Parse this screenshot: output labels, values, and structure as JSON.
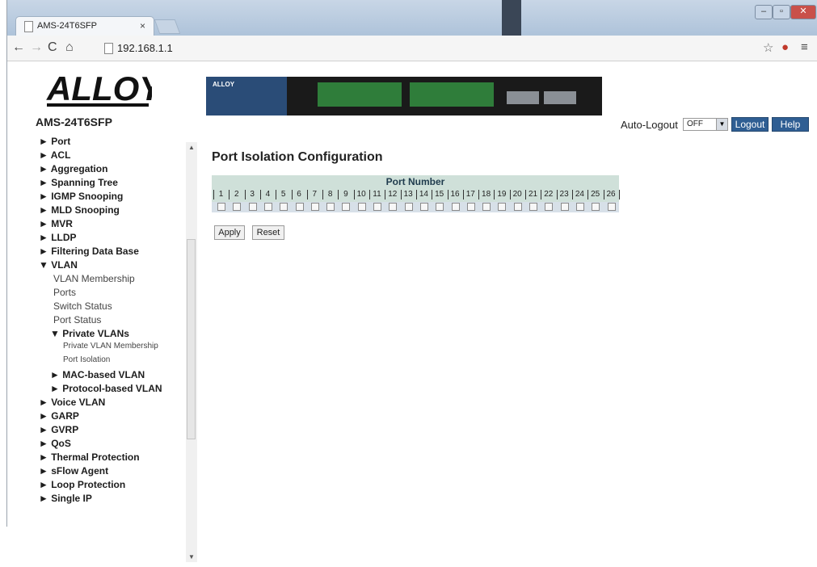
{
  "browser": {
    "tab_title": "AMS-24T6SFP",
    "url": "192.168.1.1"
  },
  "header": {
    "logo_text": "ALLOY",
    "model": "AMS-24T6SFP",
    "auto_logout_label": "Auto-Logout",
    "auto_logout_value": "OFF",
    "logout_label": "Logout",
    "help_label": "Help"
  },
  "sidebar": {
    "items": [
      {
        "label": "► Port",
        "style": "b",
        "indent": 1
      },
      {
        "label": "► ACL",
        "style": "b",
        "indent": 1
      },
      {
        "label": "► Aggregation",
        "style": "b",
        "indent": 1
      },
      {
        "label": "► Spanning Tree",
        "style": "b",
        "indent": 1
      },
      {
        "label": "► IGMP Snooping",
        "style": "b",
        "indent": 1
      },
      {
        "label": "► MLD Snooping",
        "style": "b",
        "indent": 1
      },
      {
        "label": "► MVR",
        "style": "b",
        "indent": 1
      },
      {
        "label": "► LLDP",
        "style": "b",
        "indent": 1
      },
      {
        "label": "► Filtering Data Base",
        "style": "b",
        "indent": 1
      },
      {
        "label": "▼ VLAN",
        "style": "b",
        "indent": 1
      },
      {
        "label": "VLAN Membership",
        "style": "l",
        "indent": 2
      },
      {
        "label": "Ports",
        "style": "l",
        "indent": 2
      },
      {
        "label": "Switch Status",
        "style": "l",
        "indent": 2
      },
      {
        "label": "Port Status",
        "style": "l",
        "indent": 2
      },
      {
        "label": "▼ Private VLANs",
        "style": "b",
        "indent": 3
      },
      {
        "label": "Private VLAN Membership",
        "style": "s",
        "indent": 4
      },
      {
        "label": "Port Isolation",
        "style": "s",
        "indent": 4
      },
      {
        "label": "► MAC-based VLAN",
        "style": "b",
        "indent": 3
      },
      {
        "label": "► Protocol-based VLAN",
        "style": "b",
        "indent": 3
      },
      {
        "label": "► Voice VLAN",
        "style": "b",
        "indent": 1
      },
      {
        "label": "► GARP",
        "style": "b",
        "indent": 1
      },
      {
        "label": "► GVRP",
        "style": "b",
        "indent": 1
      },
      {
        "label": "► QoS",
        "style": "b",
        "indent": 1
      },
      {
        "label": "► Thermal Protection",
        "style": "b",
        "indent": 1
      },
      {
        "label": "► sFlow Agent",
        "style": "b",
        "indent": 1
      },
      {
        "label": "► Loop Protection",
        "style": "b",
        "indent": 1
      },
      {
        "label": "► Single IP",
        "style": "b",
        "indent": 1
      }
    ]
  },
  "main": {
    "title": "Port Isolation Configuration",
    "table_header": "Port Number",
    "ports": [
      "1",
      "2",
      "3",
      "4",
      "5",
      "6",
      "7",
      "8",
      "9",
      "10",
      "11",
      "12",
      "13",
      "14",
      "15",
      "16",
      "17",
      "18",
      "19",
      "20",
      "21",
      "22",
      "23",
      "24",
      "25",
      "26"
    ],
    "checked": [
      false,
      false,
      false,
      false,
      false,
      false,
      false,
      false,
      false,
      false,
      false,
      false,
      false,
      false,
      false,
      false,
      false,
      false,
      false,
      false,
      false,
      false,
      false,
      false,
      false,
      false
    ],
    "apply_label": "Apply",
    "reset_label": "Reset"
  },
  "colors": {
    "button_blue": "#2f5e93",
    "table_header_bg": "#cfe0d9"
  }
}
